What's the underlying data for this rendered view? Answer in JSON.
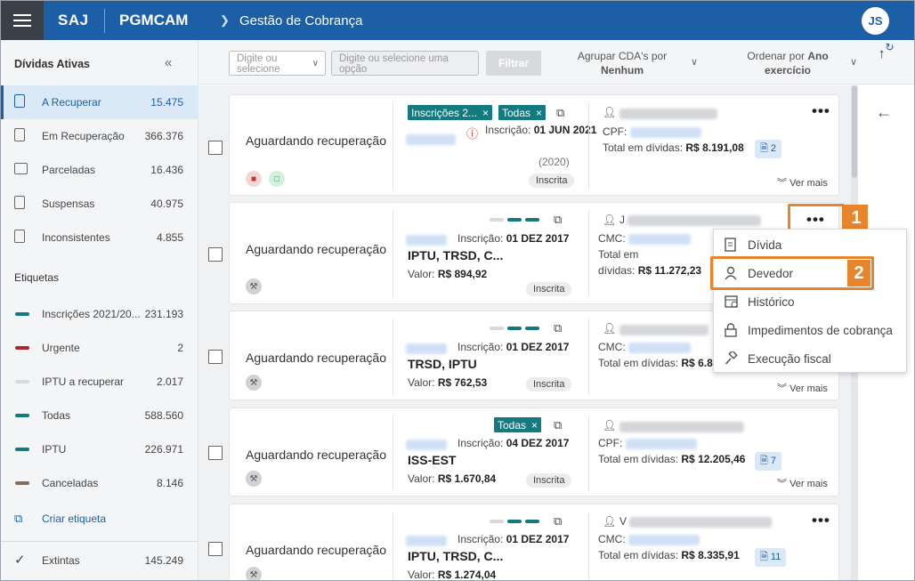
{
  "header": {
    "brand": "SAJ",
    "app": "PGMCAM",
    "breadcrumb": "Gestão de Cobrança",
    "avatar": "JS"
  },
  "sidebar": {
    "title": "Dívidas Ativas",
    "items": [
      {
        "label": "A Recuperar",
        "count": "15.475"
      },
      {
        "label": "Em Recuperação",
        "count": "366.376"
      },
      {
        "label": "Parceladas",
        "count": "16.436"
      },
      {
        "label": "Suspensas",
        "count": "40.975"
      },
      {
        "label": "Inconsistentes",
        "count": "4.855"
      }
    ],
    "tags_title": "Etiquetas",
    "tags": [
      {
        "label": "Inscrições 2021/20...",
        "count": "231.193",
        "color": "#137a7f"
      },
      {
        "label": "Urgente",
        "count": "2",
        "color": "#b3262e"
      },
      {
        "label": "IPTU a recuperar",
        "count": "2.017",
        "color": "#d8d9dc"
      },
      {
        "label": "Todas",
        "count": "588.560",
        "color": "#137a7f"
      },
      {
        "label": "IPTU",
        "count": "226.971",
        "color": "#137a7f"
      },
      {
        "label": "Canceladas",
        "count": "8.146",
        "color": "#8b6a5e"
      }
    ],
    "create_tag": "Criar etiqueta",
    "extinct": {
      "label": "Extintas",
      "count": "145.249"
    }
  },
  "toolbar": {
    "select1_placeholder": "Digite ou selecione",
    "select2_placeholder": "Digite ou selecione uma opção",
    "filter": "Filtrar",
    "group_label": "Agrupar CDA's por",
    "group_value": "Nenhum",
    "order_label": "Ordenar por",
    "order_value1": "Ano",
    "order_value2": "exercício"
  },
  "cards": [
    {
      "status": "Aguardando recuperação",
      "chips": [
        "Inscrições 2...",
        "Todas"
      ],
      "inscricao_label": "Inscrição:",
      "inscricao": "01 JUN 2021",
      "year": "(2020)",
      "badge": "Inscrita",
      "doc_label": "CPF:",
      "total_label": "Total em dívidas:",
      "total": "R$ 8.191,08",
      "count": "2",
      "more": "Ver mais"
    },
    {
      "status": "Aguardando recuperação",
      "inscricao_label": "Inscrição:",
      "inscricao": "01 DEZ 2017",
      "tributes": "IPTU, TRSD, C...",
      "valor_label": "Valor:",
      "valor": "R$ 894,92",
      "badge": "Inscrita",
      "person_initial": "J",
      "doc_label": "CMC:",
      "total_label1": "Total em",
      "total_label2": "dívidas:",
      "total": "R$ 11.272,23"
    },
    {
      "status": "Aguardando recuperação",
      "inscricao_label": "Inscrição:",
      "inscricao": "01 DEZ 2017",
      "tributes": "TRSD, IPTU",
      "valor_label": "Valor:",
      "valor": "R$ 762,53",
      "badge": "Inscrita",
      "doc_label": "CMC:",
      "total_label": "Total em dívidas:",
      "total": "R$ 6.8",
      "more": "Ver mais"
    },
    {
      "status": "Aguardando recuperação",
      "chips": [
        "Todas"
      ],
      "inscricao_label": "Inscrição:",
      "inscricao": "04 DEZ 2017",
      "tributes": "ISS-EST",
      "valor_label": "Valor:",
      "valor": "R$ 1.670,84",
      "badge": "Inscrita",
      "doc_label": "CPF:",
      "total_label": "Total em dívidas:",
      "total": "R$ 12.205,46",
      "count": "7",
      "more": "Ver mais"
    },
    {
      "status": "Aguardando recuperação",
      "inscricao_label": "Inscrição:",
      "inscricao": "01 DEZ 2017",
      "tributes": "IPTU, TRSD, C...",
      "valor_label": "Valor:",
      "valor": "R$ 1.274,04",
      "person_initial": "V",
      "doc_label": "CMC:",
      "total_label": "Total em dívidas:",
      "total": "R$ 8.335,91",
      "count": "11"
    }
  ],
  "menu": {
    "items": [
      "Dívida",
      "Devedor",
      "Histórico",
      "Impedimentos de cobrança",
      "Execução fiscal"
    ],
    "step1": "1",
    "step2": "2"
  },
  "colors": {
    "primary": "#1d5fa6",
    "teal": "#137a7f",
    "highlight": "#e8842c"
  }
}
